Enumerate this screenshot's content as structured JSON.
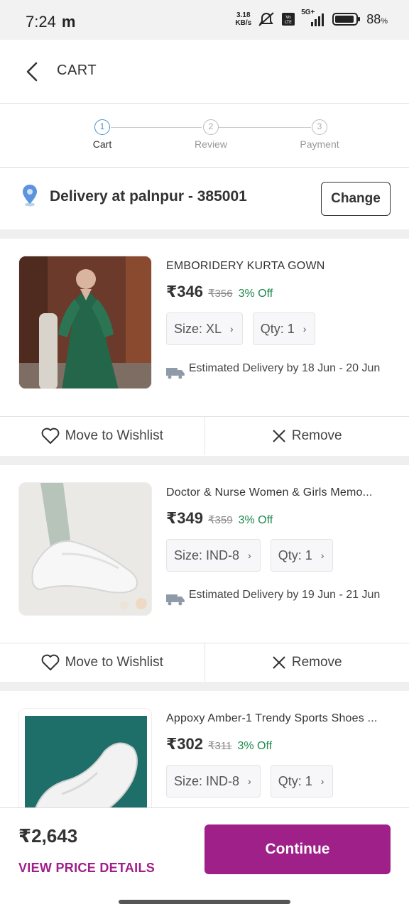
{
  "status_bar": {
    "time": "7:24",
    "carrier_icon": "m",
    "speed_value": "3.18",
    "speed_unit": "KB/s",
    "network": "5G+",
    "battery": "88",
    "battery_unit": "%"
  },
  "header": {
    "title": "CART"
  },
  "stepper": {
    "steps": [
      {
        "number": "1",
        "label": "Cart"
      },
      {
        "number": "2",
        "label": "Review"
      },
      {
        "number": "3",
        "label": "Payment"
      }
    ],
    "active_step": 1
  },
  "delivery": {
    "text": "Delivery at palnpur  - 385001",
    "change_label": "Change"
  },
  "items": [
    {
      "title": "EMBORIDERY KURTA GOWN",
      "price": "₹346",
      "mrp": "₹356",
      "off": "3% Off",
      "size": "Size: XL",
      "qty": "Qty: 1",
      "eta": "Estimated Delivery by 18 Jun - 20 Jun"
    },
    {
      "title": "Doctor & Nurse Women & Girls Memo...",
      "price": "₹349",
      "mrp": "₹359",
      "off": "3% Off",
      "size": "Size: IND-8",
      "qty": "Qty: 1",
      "eta": "Estimated Delivery by 19 Jun - 21 Jun"
    },
    {
      "title": "Appoxy Amber-1 Trendy Sports Shoes ...",
      "price": "₹302",
      "mrp": "₹311",
      "off": "3% Off",
      "size": "Size: IND-8",
      "qty": "Qty: 1"
    }
  ],
  "actions": {
    "wishlist_label": "Move to Wishlist",
    "remove_label": "Remove"
  },
  "footer": {
    "total": "₹2,643",
    "view_details": "VIEW PRICE DETAILS",
    "continue_label": "Continue"
  },
  "colors": {
    "accent": "#9f2089",
    "discount": "#1d8a4d",
    "step_active": "#4a90c8"
  }
}
